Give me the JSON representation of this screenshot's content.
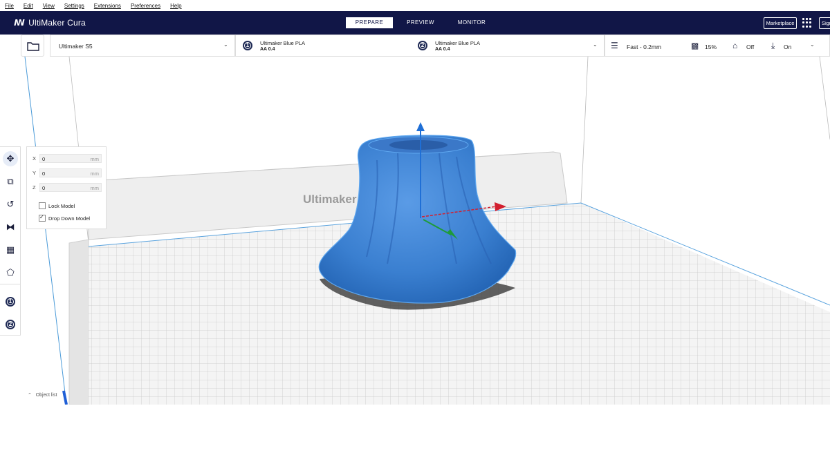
{
  "menu": {
    "items": [
      {
        "label": "File"
      },
      {
        "label": "Edit"
      },
      {
        "label": "View"
      },
      {
        "label": "Settings"
      },
      {
        "label": "Extensions"
      },
      {
        "label": "Preferences"
      },
      {
        "label": "Help"
      }
    ]
  },
  "header": {
    "brand": "UltiMaker Cura",
    "stages": [
      {
        "label": "PREPARE"
      },
      {
        "label": "PREVIEW"
      },
      {
        "label": "MONITOR"
      }
    ],
    "marketplace": "Marketplace",
    "signin": "Sign"
  },
  "toolbar": {
    "printer": "Ultimaker S5",
    "extruder1": {
      "badge": "1",
      "material": "Ultimaker Blue PLA",
      "core": "AA 0.4"
    },
    "extruder2": {
      "badge": "2",
      "material": "Ultimaker Blue PLA",
      "core": "AA 0.4"
    },
    "profile": "Fast - 0.2mm",
    "infill": "15%",
    "support": "Off",
    "adhesion": "On"
  },
  "move_tool": {
    "x": {
      "label": "X",
      "value": "0",
      "unit": "mm"
    },
    "y": {
      "label": "Y",
      "value": "0",
      "unit": "mm"
    },
    "z": {
      "label": "Z",
      "value": "0",
      "unit": "mm"
    },
    "lock_model": {
      "label": "Lock Model",
      "checked": false
    },
    "drop_down_model": {
      "label": "Drop Down Model",
      "checked": true
    }
  },
  "left_tools": {
    "extruder_badges": [
      "1",
      "2"
    ]
  },
  "viewport": {
    "backplate_text": "Ultimaker",
    "object_list": "Object list"
  },
  "colors": {
    "header_bg": "#111647",
    "model_blue": "#3a7fd0",
    "accent": "#1f5fd6"
  }
}
